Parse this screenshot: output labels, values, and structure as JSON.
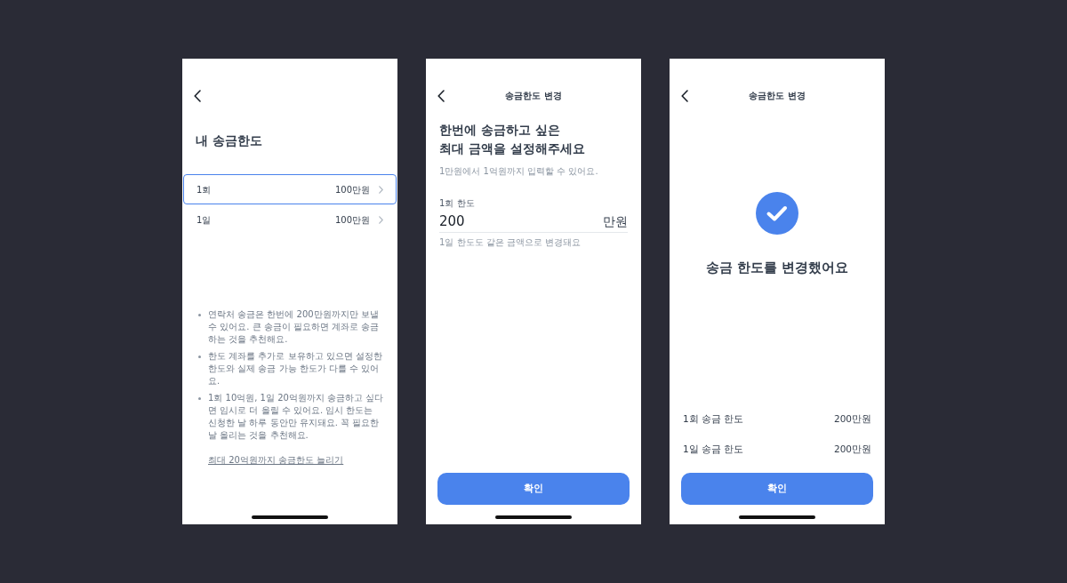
{
  "screens": [
    {
      "kind": "overview",
      "title": "내 송금한도",
      "limits": [
        {
          "label": "1회",
          "value": "100만원",
          "selected": true
        },
        {
          "label": "1일",
          "value": "100만원",
          "selected": false
        }
      ],
      "notes": [
        "연락처 송금은 한번에 200만원까지만 보낼 수 있어요. 큰 송금이 필요하면 계좌로 송금하는 것을 추천해요.",
        "한도 계좌를 추가로 보유하고 있으면 설정한 한도와 실제 송금 가능 한도가 다를 수 있어요.",
        "1회 10억원, 1일 20억원까지 송금하고 싶다면 임시로 더 올릴 수 있어요. 임시 한도는 신청한 날 하루 동안만 유지돼요. 꼭 필요한 날 올리는 것을 추천해요."
      ],
      "link": "최대 20억원까지 송금한도 늘리기"
    },
    {
      "kind": "edit",
      "header": "송금한도 변경",
      "heading": "한번에 송금하고 싶은\n최대 금액을 설정해주세요",
      "hint": "1만원에서 1억원까지 입력할 수 있어요.",
      "field": {
        "label": "1회 한도",
        "value": "200",
        "unit": "만원",
        "helper": "1일 한도도 같은 금액으로 변경돼요"
      },
      "button": "확인"
    },
    {
      "kind": "done",
      "header": "송금한도 변경",
      "message": "송금 한도를 변경했어요",
      "summary": [
        {
          "label": "1회 송금 한도",
          "value": "200만원"
        },
        {
          "label": "1일 송금 한도",
          "value": "200만원"
        }
      ],
      "button": "확인"
    }
  ]
}
